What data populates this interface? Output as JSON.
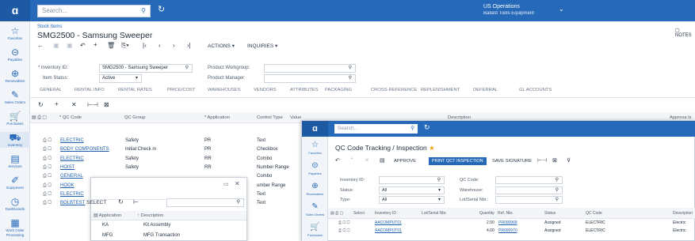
{
  "topbar": {
    "search_placeholder": "Search...",
    "org_name": "US Operations",
    "org_sub": "Ballast Tools Equipment"
  },
  "sidebar": [
    {
      "glyph": "☆",
      "label": "Favorites"
    },
    {
      "glyph": "⊝",
      "label": "Payables"
    },
    {
      "glyph": "⊕",
      "label": "Receivables"
    },
    {
      "glyph": "✎",
      "label": "Sales Orders"
    },
    {
      "glyph": "🛒",
      "label": "Purchases"
    },
    {
      "glyph": "⛟",
      "label": "Inventory"
    },
    {
      "glyph": "▤",
      "label": "Services"
    },
    {
      "glyph": "✐",
      "label": "Equipment"
    },
    {
      "glyph": "◷",
      "label": "Dashboards"
    },
    {
      "glyph": "▦",
      "label": "Work Order Processing"
    }
  ],
  "header": {
    "breadcrumb": "Stock Items",
    "title": "SMG2500 - Samsung Sweeper",
    "notes": "NOTES",
    "actions": "ACTIONS ▾",
    "inquiries": "INQUIRIES ▾"
  },
  "form": {
    "inventory_id_label": "* Inventory ID:",
    "inventory_id": "SMG2500 - Samsung Sweeper",
    "item_status_label": "Item Status:",
    "item_status": "Active",
    "workgroup_label": "Product Workgroup:",
    "manager_label": "Product Manager:"
  },
  "tabs": [
    "GENERAL",
    "RENTAL INFO",
    "RENTAL RATES",
    "PRICE/COST",
    "WAREHOUSES",
    "VENDORS",
    "ATTRIBUTES",
    "PACKAGING",
    "CROSS-REFERENCE",
    "REPLENISHMENT",
    "DEFERRAL",
    "GL ACCOUNTS"
  ],
  "grid": {
    "headers": [
      "* QC Code",
      "QC Group",
      "* Application",
      "Control Type",
      "Value",
      "Description",
      "Approva ls"
    ],
    "rows": [
      {
        "code": "ELECTRIC",
        "group": "Safety",
        "app": "PR",
        "ctrl": "Text"
      },
      {
        "code": "BODY COMPONENTS",
        "group": "Initial Check in",
        "app": "PR",
        "ctrl": "Checkbox"
      },
      {
        "code": "ELECTRIC",
        "group": "Safety",
        "app": "RR",
        "ctrl": "Combo"
      },
      {
        "code": "HOIST",
        "group": "Safety",
        "app": "RR",
        "ctrl": "Number Range"
      },
      {
        "code": "GENERAL",
        "group": "",
        "app": "",
        "ctrl": "Combo"
      },
      {
        "code": "HOOK",
        "group": "",
        "app": "",
        "ctrl": "umber Range"
      },
      {
        "code": "ELECTRIC",
        "group": "",
        "app": "",
        "ctrl": "Text"
      },
      {
        "code": "BOLBTEST",
        "group": "",
        "app": "",
        "ctrl": "Text"
      }
    ]
  },
  "popup1": {
    "select": "SELECT",
    "headers": [
      "Application",
      "Description"
    ],
    "rows": [
      [
        "KA",
        "Kit Assembly"
      ],
      [
        "MFG",
        "MFG Transaction"
      ]
    ]
  },
  "popup2": {
    "search_placeholder": "Search...",
    "title": "QC Code Tracking / Inspection",
    "approve": "APPROVE",
    "print": "PRINT QCT INSPECTION",
    "save_sig": "SAVE SIGNATURE",
    "inv_label": "Inventory ID:",
    "status_label": "Status:",
    "status_val": "All",
    "type_label": "Type:",
    "type_val": "All",
    "qc_label": "QC Code:",
    "wh_label": "Warehouse:",
    "lot_label": "Lot/Serial Nbr.:",
    "headers": [
      "Select",
      "Inventory ID",
      "Lot/Serial Nbr.",
      "Quantity",
      "Ref. Nbr.",
      "Status",
      "QC Code",
      "Description"
    ],
    "rows": [
      {
        "inv": "AACOMPUT01",
        "qty": "2.00",
        "ref": "PR000968",
        "status": "Assigned",
        "qc": "ELECTRIC",
        "desc": "Electric"
      },
      {
        "inv": "AACOMPUT01",
        "qty": "4.00",
        "ref": "PR000970",
        "status": "Assigned",
        "qc": "ELECTRIC",
        "desc": "Electric"
      }
    ]
  }
}
